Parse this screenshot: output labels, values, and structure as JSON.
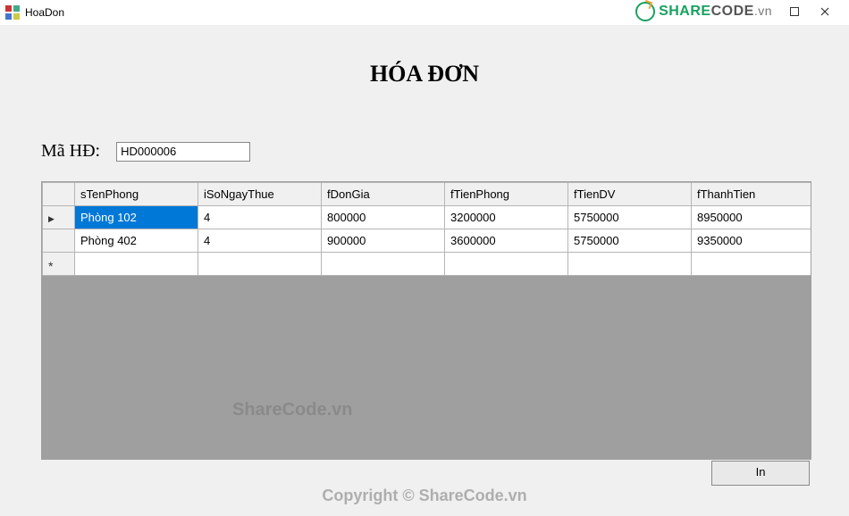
{
  "window": {
    "title": "HoaDon",
    "logo": {
      "share": "SHARE",
      "code": "CODE",
      "suffix": ".vn"
    }
  },
  "heading": "HÓA ĐƠN",
  "field": {
    "label": "Mã HĐ:",
    "value": "HD000006"
  },
  "grid": {
    "columns": [
      "sTenPhong",
      "iSoNgayThue",
      "fDonGia",
      "fTienPhong",
      "fTienDV",
      "fThanhTien"
    ],
    "rows": [
      {
        "sTenPhong": "Phòng 102",
        "iSoNgayThue": "4",
        "fDonGia": "800000",
        "fTienPhong": "3200000",
        "fTienDV": "5750000",
        "fThanhTien": "8950000"
      },
      {
        "sTenPhong": "Phòng 402",
        "iSoNgayThue": "4",
        "fDonGia": "900000",
        "fTienPhong": "3600000",
        "fTienDV": "5750000",
        "fThanhTien": "9350000"
      }
    ]
  },
  "buttons": {
    "print": "In"
  },
  "watermarks": {
    "mid": "ShareCode.vn",
    "bottom": "Copyright © ShareCode.vn"
  }
}
